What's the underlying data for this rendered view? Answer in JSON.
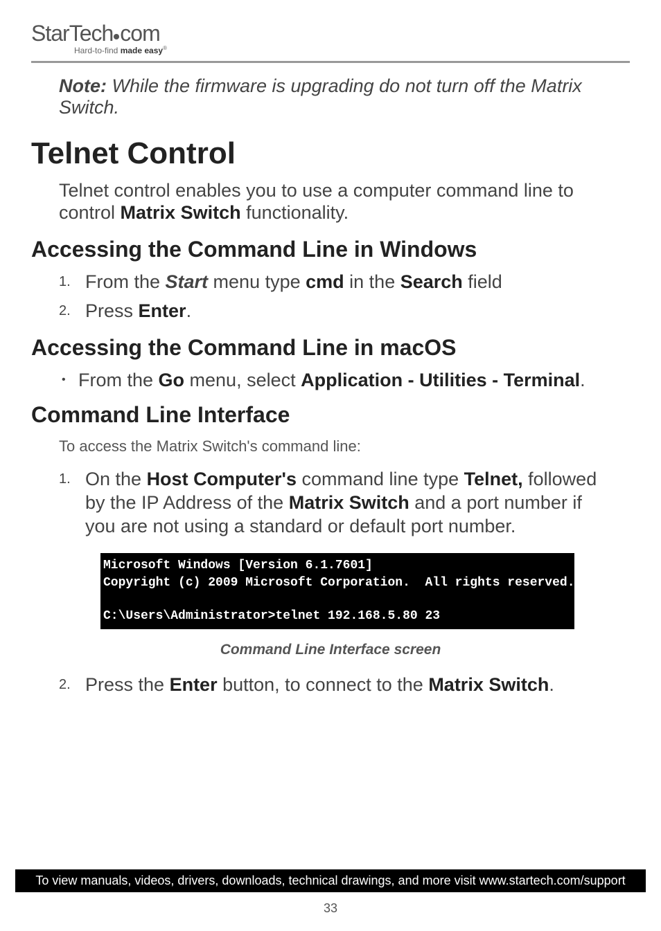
{
  "logo": {
    "brand_prefix": "StarTech",
    "brand_suffix": "com",
    "tagline_prefix": "Hard-to-find ",
    "tagline_bold": "made easy",
    "reg": "®"
  },
  "note": {
    "label": "Note:",
    "text": " While the firmware is upgrading do not turn off the Matrix Switch."
  },
  "h1": "Telnet Control",
  "intro": {
    "pre": "Telnet control enables you to use a computer command line to control ",
    "bold": "Matrix Switch",
    "post": " functionality."
  },
  "h2_windows": "Accessing the Command Line in Windows",
  "list_windows": {
    "item1": {
      "num": "1.",
      "t1": "From the ",
      "b1": "Start",
      "t2": " menu type ",
      "b2": "cmd",
      "t3": " in the ",
      "b3": "Search",
      "t4": " field"
    },
    "item2": {
      "num": "2.",
      "t1": "Press ",
      "b1": "Enter",
      "t2": "."
    }
  },
  "h2_macos": "Accessing the Command Line in macOS",
  "list_macos": {
    "item1": {
      "t1": "From the ",
      "b1": "Go",
      "t2": " menu, select ",
      "b2": "Application - Utilities - Terminal",
      "t3": "."
    }
  },
  "h2_cli": "Command Line Interface",
  "cli_intro": "To access the Matrix Switch's command line:",
  "list_cli": {
    "item1": {
      "num": "1.",
      "t1": "On the ",
      "b1": "Host Computer's",
      "t2": " command line type ",
      "b2": "Telnet,",
      "t3": " followed by the IP Address of the ",
      "b3": "Matrix Switch",
      "t4": " and a port number if you are not using a standard or default port number."
    },
    "item2": {
      "num": "2.",
      "t1": "Press the ",
      "b1": "Enter",
      "t2": " button, to connect to the ",
      "b2": "Matrix Switch",
      "t3": "."
    }
  },
  "cli_screenshot": "Microsoft Windows [Version 6.1.7601]\nCopyright (c) 2009 Microsoft Corporation.  All rights reserved.\n\nC:\\Users\\Administrator>telnet 192.168.5.80 23",
  "cli_caption": "Command Line Interface screen",
  "footer": "To view manuals, videos, drivers, downloads, technical drawings, and more visit www.startech.com/support",
  "page_number": "33"
}
